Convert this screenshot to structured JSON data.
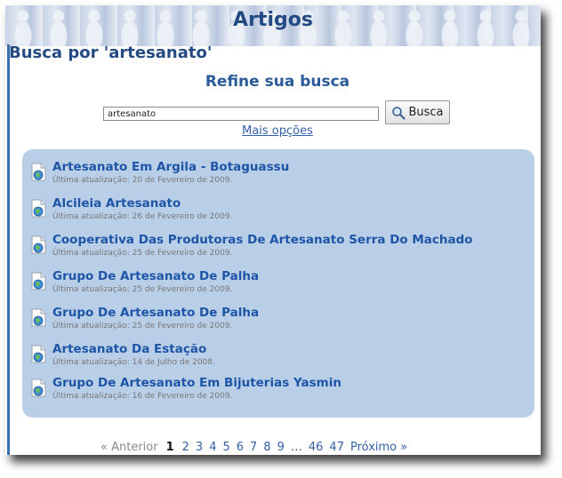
{
  "header": {
    "title": "Artigos"
  },
  "search": {
    "heading": "Busca por 'artesanato'",
    "refine_label": "Refine sua busca",
    "query": "artesanato",
    "button_label": "Busca",
    "more_options": "Mais opções"
  },
  "results": [
    {
      "title": "Artesanato Em Argila - Botaguassu",
      "updated": "Última atualização: 20 de Fevereiro de 2009."
    },
    {
      "title": "Alcileia Artesanato",
      "updated": "Última atualização: 26 de Fevereiro de 2009."
    },
    {
      "title": "Cooperativa Das Produtoras De Artesanato Serra Do Machado",
      "updated": "Última atualização: 25 de Fevereiro de 2009."
    },
    {
      "title": "Grupo De Artesanato De Palha",
      "updated": "Última atualização: 25 de Fevereiro de 2009."
    },
    {
      "title": "Grupo De Artesanato De Palha",
      "updated": "Última atualização: 25 de Fevereiro de 2009."
    },
    {
      "title": "Artesanato Da Estação",
      "updated": "Última atualização: 14 de Julho de 2008."
    },
    {
      "title": "Grupo De Artesanato Em Bijuterias Yasmin",
      "updated": "Última atualização: 16 de Fevereiro de 2009."
    }
  ],
  "pagination": {
    "prev": "« Anterior",
    "current": "1",
    "pages": [
      "2",
      "3",
      "4",
      "5",
      "6",
      "7",
      "8",
      "9"
    ],
    "ellipsis": "…",
    "tail_pages": [
      "46",
      "47"
    ],
    "next": "Próximo »"
  },
  "icons": {
    "search_button": "magnifier-icon",
    "result": "globe-document-icon"
  },
  "colors": {
    "accent": "#244a84",
    "link": "#1f55a6",
    "results_bg": "#b9cfe8"
  }
}
